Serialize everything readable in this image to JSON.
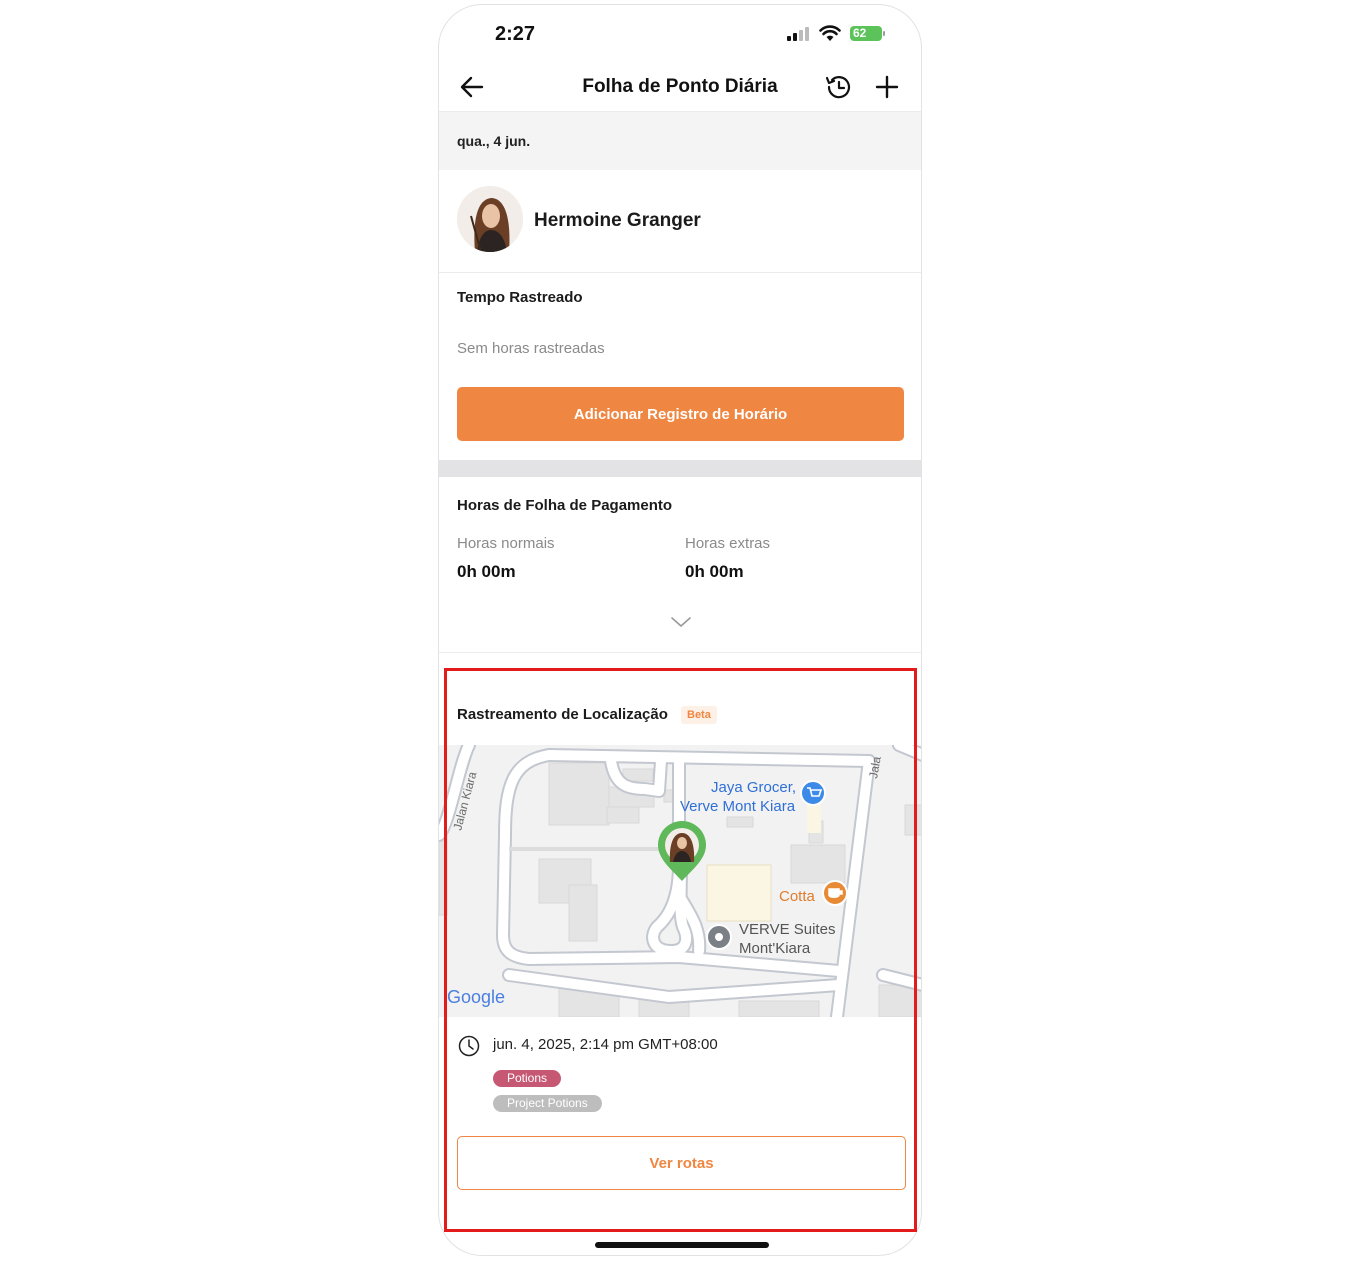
{
  "status_bar": {
    "time": "2:27",
    "battery": "62"
  },
  "header": {
    "title": "Folha de Ponto Diária"
  },
  "date": "qua., 4 jun.",
  "user": {
    "name": "Hermoine Granger"
  },
  "tracked_time": {
    "title": "Tempo Rastreado",
    "empty_text": "Sem horas rastreadas",
    "add_button": "Adicionar Registro de Horário"
  },
  "payroll": {
    "title": "Horas de Folha de Pagamento",
    "regular_label": "Horas normais",
    "regular_value": "0h 00m",
    "overtime_label": "Horas extras",
    "overtime_value": "0h 00m"
  },
  "location": {
    "title": "Rastreamento de Localização",
    "badge": "Beta",
    "map": {
      "labels": {
        "grocer_line1": "Jaya Grocer,",
        "grocer_line2": "Verve Mont Kiara",
        "cafe": "Cotta",
        "suites_line1": "VERVE Suites",
        "suites_line2": "Mont'Kiara",
        "street_left": "Jalan Kiara",
        "street_right": "Jala",
        "google": "Google"
      }
    },
    "timestamp": "jun. 4, 2025, 2:14 pm GMT+08:00",
    "tags": [
      "Potions",
      "Project Potions"
    ],
    "routes_button": "Ver rotas"
  },
  "colors": {
    "accent": "#ef8641",
    "highlight": "#e31b1b",
    "tag_potions": "#c65873",
    "tag_project": "#bdbdbd",
    "pin": "#5fb85a"
  }
}
